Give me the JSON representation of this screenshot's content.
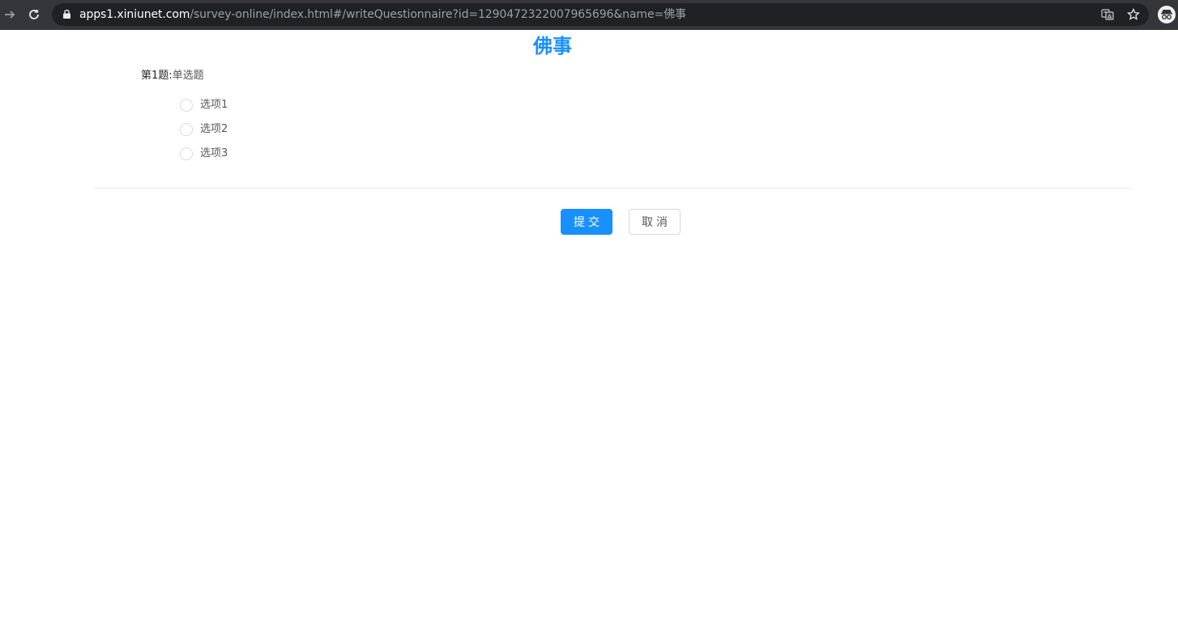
{
  "browser": {
    "url_host": "apps1.xiniunet.com",
    "url_path": "/survey-online/index.html#/writeQuestionnaire?id=1290472322007965696&name=佛事"
  },
  "page": {
    "title": "佛事"
  },
  "question": {
    "number_label": "第1题:",
    "type_label": "单选题",
    "options": [
      {
        "label": "选项1"
      },
      {
        "label": "选项2"
      },
      {
        "label": "选项3"
      }
    ]
  },
  "actions": {
    "submit_label": "提交",
    "cancel_label": "取消"
  },
  "colors": {
    "primary": "#1890ff",
    "chrome_bg": "#35363a",
    "omnibox_bg": "#202124"
  }
}
